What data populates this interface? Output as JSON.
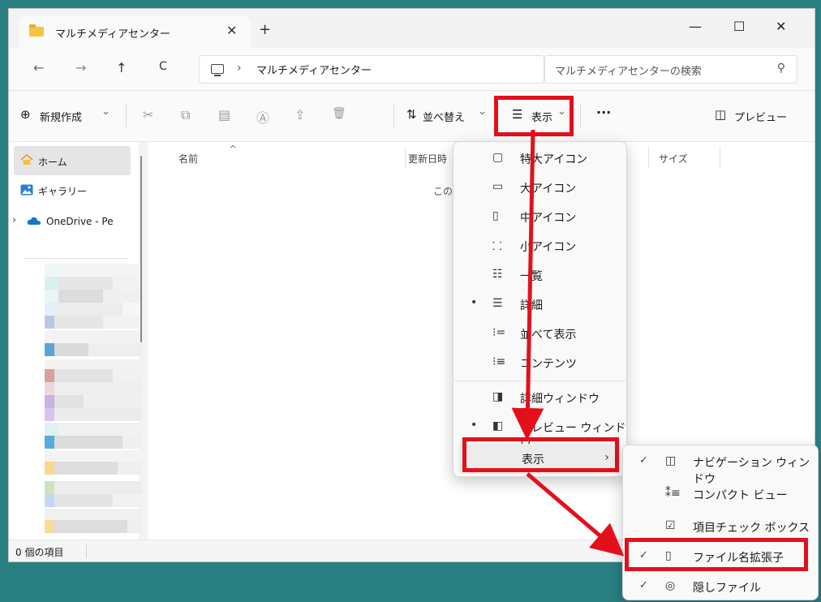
{
  "window": {
    "tab_title": "マルチメディアセンター",
    "tab_close": "✕",
    "new_tab": "+",
    "minimize": "—",
    "maximize": "☐",
    "close": "✕"
  },
  "nav": {
    "back": "←",
    "forward": "→",
    "up": "↑",
    "refresh": "C",
    "separator": "›",
    "path": "マルチメディアセンター",
    "search_placeholder": "マルチメディアセンターの検索",
    "search_icon": "⚲"
  },
  "toolbar": {
    "new_label": "新規作成",
    "new_icon": "⊕",
    "new_chevron": "⌄",
    "cut_icon": "✂",
    "copy_icon": "⧉",
    "paste_icon": "▤",
    "rename_icon": "Ⓐ",
    "share_icon": "⇪",
    "delete_icon": "🗑",
    "sort_icon": "⇅",
    "sort_label": "並べ替え",
    "sort_chevron": "⌄",
    "view_icon": "☰",
    "view_label": "表示",
    "view_chevron": "⌄",
    "more": "···",
    "preview_icon": "◫",
    "preview_label": "プレビュー"
  },
  "sidebar": {
    "items": [
      {
        "label": "ホーム",
        "icon": "home-icon"
      },
      {
        "label": "ギャラリー",
        "icon": "gallery-icon"
      },
      {
        "label": "OneDrive - Pe",
        "icon": "cloud-icon",
        "expand": "›"
      }
    ]
  },
  "columns": {
    "name": "名前",
    "modified": "更新日時",
    "size": "サイズ",
    "sort_indicator": "^"
  },
  "empty_text": "このフォ",
  "status": {
    "count": "0 個の項目"
  },
  "view_menu": {
    "items": [
      {
        "icon": "▢",
        "label": "特大アイコン",
        "dot": ""
      },
      {
        "icon": "▭",
        "label": "大アイコン",
        "dot": ""
      },
      {
        "icon": "▯",
        "label": "中アイコン",
        "dot": ""
      },
      {
        "icon": "⸬",
        "label": "小アイコン",
        "dot": ""
      },
      {
        "icon": "☷",
        "label": "一覧",
        "dot": ""
      },
      {
        "icon": "☰",
        "label": "詳細",
        "dot": "•"
      },
      {
        "icon": "⁝=",
        "label": "並べて表示",
        "dot": ""
      },
      {
        "icon": "⁝≡",
        "label": "コンテンツ",
        "dot": ""
      },
      {
        "icon": "◨",
        "label": "詳細ウィンドウ",
        "dot": ""
      },
      {
        "icon": "◧",
        "label": "プレビュー ウィンドウ",
        "dot": "•"
      }
    ],
    "show": {
      "label": "表示",
      "arrow": "›"
    }
  },
  "show_submenu": {
    "items": [
      {
        "check": "✓",
        "icon": "◫",
        "label": "ナビゲーション ウィンドウ"
      },
      {
        "check": "",
        "icon": "⁑≡",
        "label": "コンパクト ビュー"
      },
      {
        "check": "",
        "icon": "☑",
        "label": "項目チェック ボックス"
      },
      {
        "check": "✓",
        "icon": "▯",
        "label": "ファイル名拡張子"
      },
      {
        "check": "✓",
        "icon": "◎",
        "label": "隠しファイル"
      }
    ]
  },
  "colors": {
    "background": "#2a7f82",
    "highlight": "#e3101c",
    "folder": "#f5c542",
    "onedrive": "#1a73c8"
  }
}
